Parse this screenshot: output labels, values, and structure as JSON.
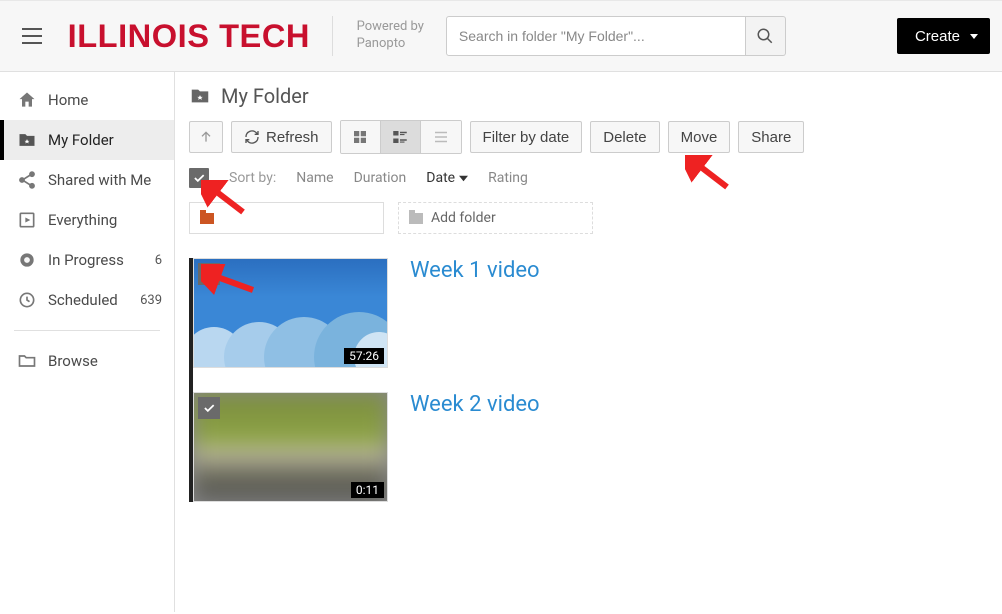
{
  "header": {
    "logo_text": "ILLINOIS TECH",
    "powered_line1": "Powered by",
    "powered_line2": "Panopto",
    "search_placeholder": "Search in folder \"My Folder\"...",
    "create_label": "Create"
  },
  "sidebar": {
    "items": [
      {
        "label": "Home",
        "icon": "home-icon",
        "count": null
      },
      {
        "label": "My Folder",
        "icon": "starred-folder-icon",
        "count": null,
        "active": true
      },
      {
        "label": "Shared with Me",
        "icon": "share-icon",
        "count": null
      },
      {
        "label": "Everything",
        "icon": "play-square-icon",
        "count": null
      },
      {
        "label": "In Progress",
        "icon": "record-icon",
        "count": "6"
      },
      {
        "label": "Scheduled",
        "icon": "clock-icon",
        "count": "639"
      }
    ],
    "browse_label": "Browse"
  },
  "main": {
    "title": "My Folder",
    "toolbar": {
      "refresh": "Refresh",
      "filter": "Filter by date",
      "delete": "Delete",
      "move": "Move",
      "share": "Share"
    },
    "sort": {
      "label": "Sort by:",
      "options": [
        "Name",
        "Duration",
        "Date",
        "Rating"
      ],
      "active": "Date"
    },
    "add_folder": "Add folder",
    "videos": [
      {
        "title": "Week 1 video",
        "duration": "57:26"
      },
      {
        "title": "Week 2 video",
        "duration": "0:11"
      }
    ]
  },
  "colors": {
    "brand_red": "#C8102E",
    "link_blue": "#2a8bd1"
  }
}
